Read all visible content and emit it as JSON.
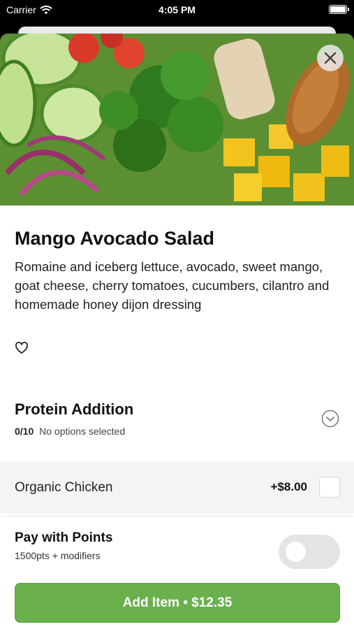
{
  "status_bar": {
    "carrier": "Carrier",
    "time": "4:05 PM"
  },
  "item": {
    "title": "Mango Avocado Salad",
    "description": "Romaine and iceberg lettuce, avocado, sweet mango, goat cheese, cherry tomatoes, cucumbers, cilantro and homemade honey dijon dressing"
  },
  "protein_section": {
    "title": "Protein Addition",
    "count": "0/10",
    "status": "No options selected"
  },
  "options": [
    {
      "name": "Organic Chicken",
      "price": "+$8.00",
      "checked": false
    }
  ],
  "points": {
    "title": "Pay with Points",
    "subtitle": "1500pts + modifiers",
    "enabled": false
  },
  "add_button": {
    "label": "Add Item • $12.35"
  },
  "colors": {
    "accent_green": "#6ab04c",
    "toggle_off": "#e4e4e4",
    "option_row_bg": "#f4f4f4"
  },
  "icons": {
    "close": "close-icon",
    "heart": "heart-icon",
    "chevron": "chevron-down-circle-icon",
    "wifi": "wifi-icon",
    "battery": "battery-icon"
  }
}
